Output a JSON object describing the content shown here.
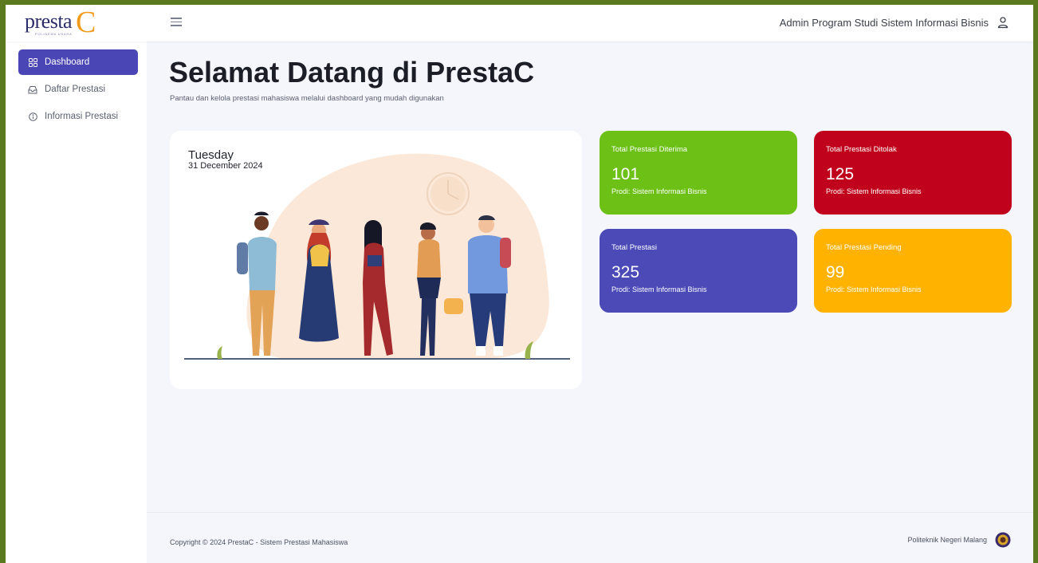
{
  "brand": {
    "logo_text": "presta",
    "logo_c": "C",
    "logo_sub": "POLINEMA USAHA"
  },
  "header": {
    "user_name": "Admin Program Studi Sistem Informasi Bisnis",
    "menu_icon": "hamburger-icon",
    "user_icon": "user-icon"
  },
  "sidebar": {
    "items": [
      {
        "label": "Dashboard",
        "icon": "grid-icon",
        "active": true
      },
      {
        "label": "Daftar Prestasi",
        "icon": "inbox-icon",
        "active": false
      },
      {
        "label": "Informasi Prestasi",
        "icon": "info-icon",
        "active": false
      }
    ]
  },
  "main": {
    "title": "Selamat Datang di PrestaC",
    "subtitle": "Pantau dan kelola prestasi mahasiswa melalui dashboard yang mudah digunakan",
    "date": {
      "day": "Tuesday",
      "full": "31 December 2024"
    },
    "stats": [
      {
        "label": "Total Prestasi Diterima",
        "value": "101",
        "prodi": "Prodi: Sistem Informasi Bisnis",
        "color": "#6cc016"
      },
      {
        "label": "Total Prestasi Ditolak",
        "value": "125",
        "prodi": "Prodi: Sistem Informasi Bisnis",
        "color": "#c0021d"
      },
      {
        "label": "Total Prestasi",
        "value": "325",
        "prodi": "Prodi: Sistem Informasi Bisnis",
        "color": "#4c4ab7"
      },
      {
        "label": "Total Prestasi Pending",
        "value": "99",
        "prodi": "Prodi: Sistem Informasi Bisnis",
        "color": "#ffb300"
      }
    ]
  },
  "footer": {
    "copyright": "Copyright © 2024 PrestaC - Sistem Prestasi Mahasiswa",
    "institution": "Politeknik Negeri Malang"
  },
  "colors": {
    "accent": "#4b46b6",
    "background": "#f4f6fc"
  }
}
